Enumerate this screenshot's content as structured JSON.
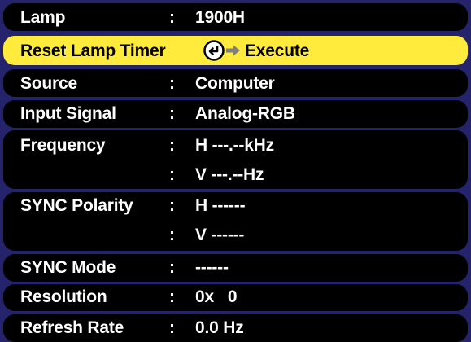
{
  "colors": {
    "background": "#25236b",
    "row": "#000000",
    "highlight": "#ffeb3b",
    "text": "#ffffff",
    "highlight_text": "#000000",
    "arrow": "#7f7f7f"
  },
  "separator": ":",
  "rows": [
    {
      "label": "Lamp",
      "value": "1900H"
    },
    {
      "label": "Reset Lamp Timer",
      "action_label": "Execute",
      "icons": [
        "enter-key-icon",
        "right-arrow-icon"
      ],
      "selected": true
    },
    {
      "label": "Source",
      "value": "Computer"
    },
    {
      "label": "Input Signal",
      "value": "Analog-RGB"
    },
    {
      "label": "Frequency",
      "value": "H ---.--kHz"
    },
    {
      "label": "",
      "value": "V ---.--Hz"
    },
    {
      "label": "SYNC Polarity",
      "value": "H ------"
    },
    {
      "label": "",
      "value": "V ------"
    },
    {
      "label": "SYNC Mode",
      "value": "------"
    },
    {
      "label": "Resolution",
      "value": "0x   0"
    },
    {
      "label": "Refresh Rate",
      "value": "0.0 Hz"
    }
  ]
}
